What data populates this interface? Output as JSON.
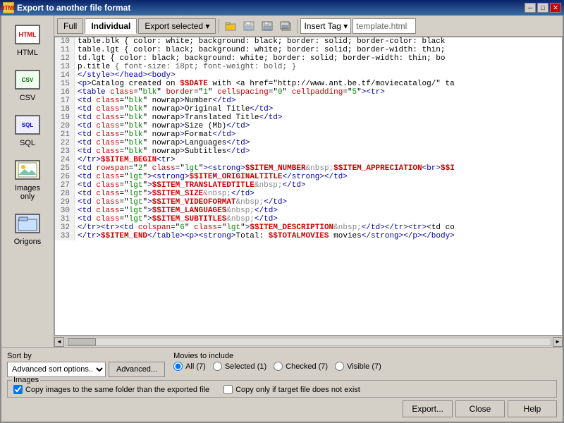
{
  "titlebar": {
    "title": "Export to another file format",
    "icon": "HTML",
    "min_btn": "─",
    "max_btn": "□",
    "close_btn": "✕"
  },
  "sidebar": {
    "items": [
      {
        "id": "html",
        "label": "HTML",
        "icon_text": "HTML",
        "icon_type": "html"
      },
      {
        "id": "csv",
        "label": "CSV",
        "icon_text": "CSV",
        "icon_type": "csv"
      },
      {
        "id": "sql",
        "label": "SQL",
        "icon_text": "SQL",
        "icon_type": "sql"
      },
      {
        "id": "images",
        "label": "Images only",
        "icon_text": "🖼",
        "icon_type": "images"
      },
      {
        "id": "origons",
        "label": "Origons",
        "icon_text": "📂",
        "icon_type": "origons"
      }
    ]
  },
  "toolbar": {
    "tabs": [
      {
        "id": "full",
        "label": "Full",
        "active": false
      },
      {
        "id": "individual",
        "label": "Individual",
        "active": true
      },
      {
        "id": "export_selected",
        "label": "Export selected ▾",
        "active": false
      }
    ],
    "icons": [
      "📁",
      "🖫",
      "💾",
      "💾"
    ],
    "insert_tag_label": "Insert Tag ▾",
    "template_file": "template.html"
  },
  "code": {
    "lines": [
      {
        "num": "10",
        "content": "  table.blk { color: white; background: black; border: solid; border-color: black"
      },
      {
        "num": "11",
        "content": "  table.lgt { color: black; background: white; border: solid; border-width: thin;"
      },
      {
        "num": "12",
        "content": "  td.lgt { color: black; background: white; border: solid; border-width: thin; bo"
      },
      {
        "num": "13",
        "content": "  p.title { font-size: 18pt; font-weight: bold; }"
      },
      {
        "num": "14",
        "content": "</style></head><body>"
      },
      {
        "num": "15",
        "content": "<p>Catalog created on $$DATE with <a href=\"http://www.ant.be.tf/moviecatalog/\" ta"
      },
      {
        "num": "16",
        "content": "<table class=\"blk\" border=\"1\" cellspacing=\"0\" cellpadding=\"5\"><tr>"
      },
      {
        "num": "17",
        "content": "<td class=\"blk\" nowrap>Number</td>"
      },
      {
        "num": "18",
        "content": "<td class=\"blk\" nowrap>Original Title</td>"
      },
      {
        "num": "19",
        "content": "<td class=\"blk\" nowrap>Translated Title</td>"
      },
      {
        "num": "20",
        "content": "<td class=\"blk\" nowrap>Size (Mb)</td>"
      },
      {
        "num": "21",
        "content": "<td class=\"blk\" nowrap>Format</td>"
      },
      {
        "num": "22",
        "content": "<td class=\"blk\" nowrap>Languages</td>"
      },
      {
        "num": "23",
        "content": "<td class=\"blk\" nowrap>Subtitles</td>"
      },
      {
        "num": "24",
        "content": "</tr>$$ITEM_BEGIN<tr>"
      },
      {
        "num": "25",
        "content": "<td rowspan=\"2\" class=\"lgt\"><strong>$$ITEM_NUMBER&nbsp;$$ITEM_APPRECIATION<br>$$I"
      },
      {
        "num": "26",
        "content": "<td class=\"lgt\"><strong>$$ITEM_ORIGINALTITLE</strong></td>"
      },
      {
        "num": "27",
        "content": "<td class=\"lgt\">$$ITEM_TRANSLATEDTITLE&nbsp;</td>"
      },
      {
        "num": "28",
        "content": "<td class=\"lgt\">$$ITEM_SIZE&nbsp;</td>"
      },
      {
        "num": "29",
        "content": "<td class=\"lgt\">$$ITEM_VIDEOFORMAT&nbsp;</td>"
      },
      {
        "num": "30",
        "content": "<td class=\"lgt\">$$ITEM_LANGUAGES&nbsp;</td>"
      },
      {
        "num": "31",
        "content": "<td class=\"lgt\">$$ITEM_SUBTITLES&nbsp;</td>"
      },
      {
        "num": "32",
        "content": "</tr><tr><td colspan=\"6\" class=\"lgt\">$$ITEM_DESCRIPTION&nbsp;</td></tr><tr><td co"
      },
      {
        "num": "33",
        "content": "</tr>$$ITEM_END</table><p><strong>Total: $$TOTALMOVIES movies</strong></p></body>"
      }
    ]
  },
  "bottom": {
    "sort_label": "Sort by",
    "sort_options": [
      "Advanced sort options..."
    ],
    "sort_selected": "Advanced sort options...",
    "advanced_btn": "Advanced...",
    "movies_label": "Movies to include",
    "radio_options": [
      {
        "id": "all",
        "label": "All (7)",
        "checked": true
      },
      {
        "id": "selected",
        "label": "Selected (1)",
        "checked": false
      },
      {
        "id": "checked",
        "label": "Checked (7)",
        "checked": false
      },
      {
        "id": "visible",
        "label": "Visible (7)",
        "checked": false
      }
    ],
    "images_group_title": "Images",
    "checkbox1_label": "Copy images to the same folder than the exported file",
    "checkbox1_checked": true,
    "checkbox2_label": "Copy only if target file does not exist",
    "checkbox2_checked": false,
    "export_btn": "Export...",
    "close_btn": "Close",
    "help_btn": "Help"
  }
}
